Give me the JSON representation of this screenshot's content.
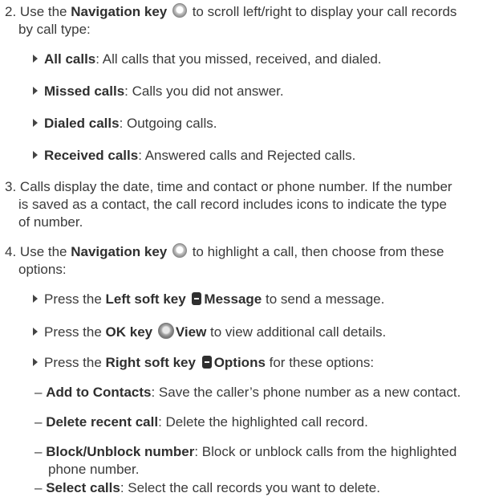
{
  "steps": [
    {
      "num": "2.",
      "line1_pre": "Use the ",
      "line1_bold": "Navigation key",
      "line1_post": " to scroll left/right to display your call records",
      "line2": "by call type:",
      "nav_icon": "navigation-key-icon"
    },
    {
      "num": "3.",
      "line1": "Calls display the date, time and contact or phone number. If the number",
      "line2": "is saved as a contact, the call record includes icons to indicate the type",
      "line3": "of number."
    },
    {
      "num": "4.",
      "line1_pre": "Use the ",
      "line1_bold": "Navigation key",
      "line1_post": " to highlight a call, then choose from these",
      "line2": "options:"
    }
  ],
  "call_types": [
    {
      "bold": "All calls",
      "text": ": All calls that you missed, received, and dialed."
    },
    {
      "bold": "Missed calls",
      "text": ": Calls you did not answer."
    },
    {
      "bold": "Dialed calls",
      "text": ": Outgoing calls."
    },
    {
      "bold": "Received calls",
      "text": ": Answered calls and Rejected calls."
    }
  ],
  "options": [
    {
      "pre": "Press the ",
      "key": "Left soft key",
      "icon": "soft-key-icon",
      "action": "Message",
      "post": " to send a message."
    },
    {
      "pre": "Press the ",
      "key": "OK key",
      "icon": "ok-key-icon",
      "action": "View",
      "post": " to view additional call details."
    },
    {
      "pre": "Press the ",
      "key": "Right soft key",
      "icon": "soft-key-icon",
      "action": "Options",
      "post": " for these options:"
    }
  ],
  "sub_options": [
    {
      "bold": "Add to Contacts",
      "line1": ": Save the caller’s phone number as a new contact.",
      "line2": ""
    },
    {
      "bold": "Delete recent call",
      "line1": ": Delete the highlighted call record.",
      "line2": ""
    },
    {
      "bold": "Block/Unblock number",
      "line1": ": Block or unblock calls from the highlighted",
      "line2": "phone number."
    },
    {
      "bold": "Select calls",
      "line1": ": Select the call records you want to delete.",
      "line2": ""
    }
  ],
  "dash": "–"
}
